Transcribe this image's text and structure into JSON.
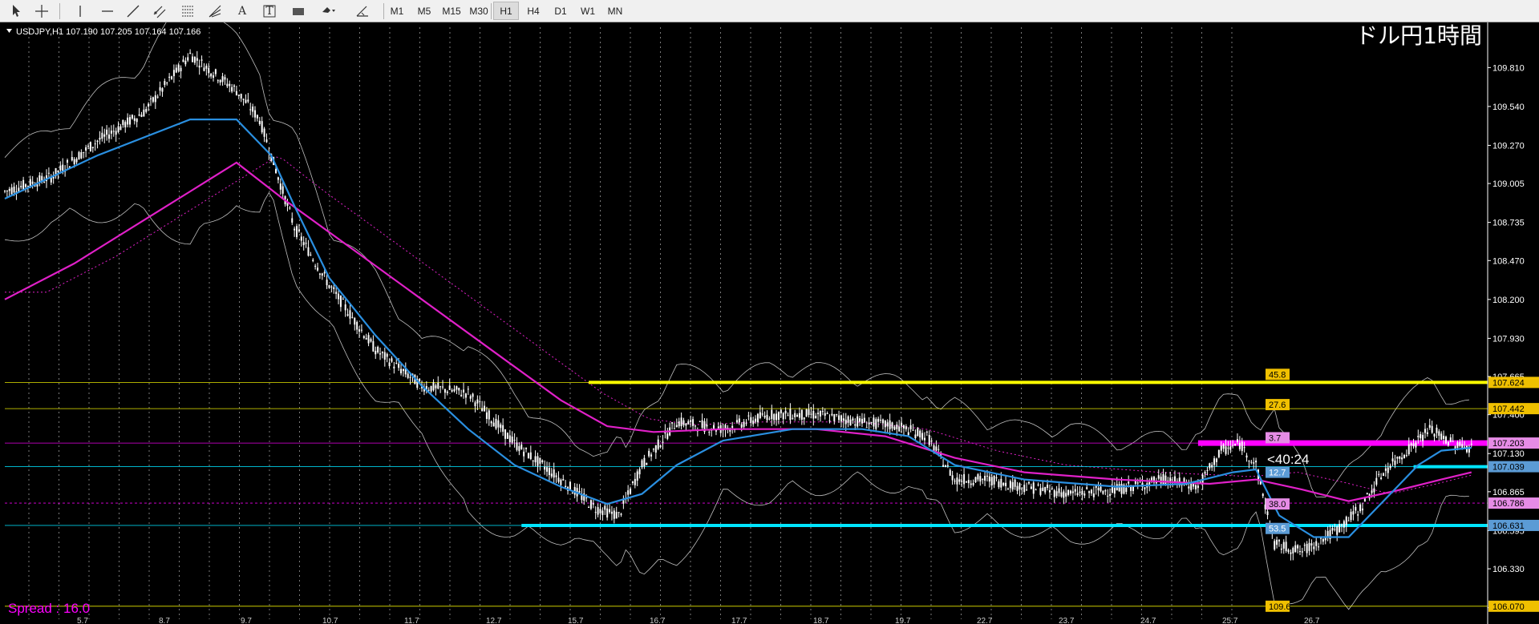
{
  "toolbar": {
    "tools": [
      {
        "name": "cursor-icon"
      },
      {
        "name": "crosshair-icon"
      },
      {
        "name": "vertical-line-icon"
      },
      {
        "name": "horizontal-line-icon"
      },
      {
        "name": "trendline-icon"
      },
      {
        "name": "equidistant-channel-icon"
      },
      {
        "name": "fibonacci-icon"
      },
      {
        "name": "fibonacci-fan-icon"
      },
      {
        "name": "text-icon"
      },
      {
        "name": "text-label-icon"
      },
      {
        "name": "rectangle-icon"
      },
      {
        "name": "arrow-shapes-icon"
      },
      {
        "name": "line-studies-icon"
      }
    ],
    "tool_glyphs": {
      "text-icon": "A",
      "text-label-icon": "T"
    },
    "timeframes": [
      "M1",
      "M5",
      "M15",
      "M30",
      "H1",
      "H4",
      "D1",
      "W1",
      "MN"
    ],
    "active_timeframe": "H1"
  },
  "header": {
    "symbol_info": "USDJPY,H1  107.190 107.205 107.164 107.166",
    "watermark": "ドル円1時間",
    "spread": "Spread : 16.0",
    "countdown": "<40:24"
  },
  "colors": {
    "background": "#000000",
    "up_candle": "#ffffff",
    "down_candle": "#ffffff",
    "ma_fast": "#2a8fe0",
    "ma_slow": "#e020c8",
    "bollinger": "#bfbfbf",
    "yellow_level": "#ffff00",
    "magenta_level": "#ff00ff",
    "cyan_level": "#00e5ff",
    "grid": "#7a7a7a"
  },
  "chart_data": {
    "type": "candlestick",
    "symbol": "USDJPY",
    "timeframe": "H1",
    "ylim": [
      105.98,
      110.09
    ],
    "y_ticks": [
      "109.810",
      "109.540",
      "109.270",
      "109.005",
      "108.735",
      "108.470",
      "108.200",
      "107.930",
      "107.665",
      "107.400",
      "107.130",
      "106.865",
      "106.595",
      "106.330",
      "106.060"
    ],
    "x_ticks": [
      "5.7",
      "8.7",
      "9.7",
      "10.7",
      "11.7",
      "12.7",
      "15.7",
      "16.7",
      "17.7",
      "18.7",
      "19.7",
      "22.7",
      "23.7",
      "24.7",
      "25.7",
      "26.7"
    ],
    "price_path": [
      [
        0,
        108.95
      ],
      [
        20,
        109.05
      ],
      [
        40,
        109.3
      ],
      [
        60,
        109.5
      ],
      [
        80,
        109.9
      ],
      [
        100,
        109.65
      ],
      [
        110,
        109.45
      ],
      [
        125,
        108.7
      ],
      [
        140,
        108.3
      ],
      [
        160,
        107.85
      ],
      [
        180,
        107.6
      ],
      [
        200,
        107.55
      ],
      [
        220,
        107.2
      ],
      [
        240,
        106.95
      ],
      [
        255,
        106.75
      ],
      [
        265,
        106.7
      ],
      [
        275,
        107.05
      ],
      [
        290,
        107.35
      ],
      [
        310,
        107.3
      ],
      [
        330,
        107.4
      ],
      [
        350,
        107.4
      ],
      [
        370,
        107.35
      ],
      [
        385,
        107.32
      ],
      [
        398,
        107.25
      ],
      [
        410,
        106.95
      ],
      [
        425,
        106.95
      ],
      [
        440,
        106.9
      ],
      [
        460,
        106.85
      ],
      [
        480,
        106.88
      ],
      [
        500,
        106.95
      ],
      [
        515,
        106.9
      ],
      [
        525,
        107.15
      ],
      [
        533,
        107.2
      ],
      [
        540,
        107.05
      ],
      [
        548,
        106.5
      ],
      [
        560,
        106.45
      ],
      [
        575,
        106.6
      ],
      [
        585,
        106.75
      ],
      [
        595,
        107.0
      ],
      [
        605,
        107.15
      ],
      [
        615,
        107.3
      ],
      [
        625,
        107.2
      ],
      [
        633,
        107.17
      ]
    ],
    "ma_fast_path": [
      [
        0,
        108.9
      ],
      [
        40,
        109.2
      ],
      [
        80,
        109.45
      ],
      [
        100,
        109.45
      ],
      [
        115,
        109.2
      ],
      [
        125,
        108.85
      ],
      [
        140,
        108.35
      ],
      [
        160,
        107.95
      ],
      [
        180,
        107.6
      ],
      [
        200,
        107.3
      ],
      [
        220,
        107.05
      ],
      [
        240,
        106.9
      ],
      [
        260,
        106.78
      ],
      [
        275,
        106.85
      ],
      [
        290,
        107.05
      ],
      [
        310,
        107.22
      ],
      [
        340,
        107.3
      ],
      [
        370,
        107.3
      ],
      [
        390,
        107.25
      ],
      [
        410,
        107.05
      ],
      [
        440,
        106.95
      ],
      [
        480,
        106.9
      ],
      [
        510,
        106.92
      ],
      [
        530,
        107.0
      ],
      [
        540,
        107.02
      ],
      [
        550,
        106.7
      ],
      [
        565,
        106.55
      ],
      [
        580,
        106.55
      ],
      [
        595,
        106.8
      ],
      [
        610,
        107.05
      ],
      [
        620,
        107.15
      ],
      [
        633,
        107.17
      ]
    ],
    "ma_slow_path": [
      [
        0,
        108.2
      ],
      [
        30,
        108.45
      ],
      [
        60,
        108.75
      ],
      [
        80,
        108.95
      ],
      [
        100,
        109.15
      ],
      [
        120,
        108.9
      ],
      [
        150,
        108.55
      ],
      [
        180,
        108.2
      ],
      [
        210,
        107.85
      ],
      [
        240,
        107.5
      ],
      [
        260,
        107.32
      ],
      [
        280,
        107.28
      ],
      [
        310,
        107.3
      ],
      [
        350,
        107.3
      ],
      [
        380,
        107.25
      ],
      [
        410,
        107.1
      ],
      [
        440,
        107.0
      ],
      [
        480,
        106.95
      ],
      [
        520,
        106.92
      ],
      [
        540,
        106.95
      ],
      [
        560,
        106.88
      ],
      [
        580,
        106.8
      ],
      [
        600,
        106.87
      ],
      [
        620,
        106.95
      ],
      [
        633,
        107.0
      ]
    ],
    "levels": [
      {
        "price": 107.624,
        "label": "107.624",
        "color": "yellow",
        "style": "solid",
        "span_from": 252,
        "thick": true
      },
      {
        "price": 107.442,
        "label": "107.442",
        "color": "yellow",
        "style": "thin",
        "span_from": 0,
        "thick": false
      },
      {
        "price": 107.203,
        "label": "107.203",
        "color": "magenta",
        "style": "solid",
        "span_from": 515,
        "thick": true
      },
      {
        "price": 107.039,
        "label": "107.039",
        "color": "cyan",
        "style": "solid",
        "span_from": 608,
        "thick": true
      },
      {
        "price": 106.786,
        "label": "106.786",
        "color": "magenta",
        "style": "dashed",
        "span_from": 0,
        "thick": false
      },
      {
        "price": 106.631,
        "label": "106.631",
        "color": "cyan",
        "style": "solid",
        "span_from": 223,
        "thick": true
      },
      {
        "price": 106.07,
        "label": "106.070",
        "color": "yellow",
        "style": "thin",
        "span_from": 0,
        "thick": false
      }
    ],
    "fib_labels": [
      {
        "price": 107.68,
        "text": "45.8",
        "color": "yellow"
      },
      {
        "price": 107.47,
        "text": "27.6",
        "color": "yellow"
      },
      {
        "price": 107.24,
        "text": "3.7",
        "color": "magenta"
      },
      {
        "price": 107.0,
        "text": "12.7",
        "color": "blue"
      },
      {
        "price": 106.78,
        "text": "38.0",
        "color": "magenta"
      },
      {
        "price": 106.61,
        "text": "53.5",
        "color": "blue"
      },
      {
        "price": 106.07,
        "text": "109.6",
        "color": "yellow"
      }
    ],
    "current_price": 107.166
  }
}
